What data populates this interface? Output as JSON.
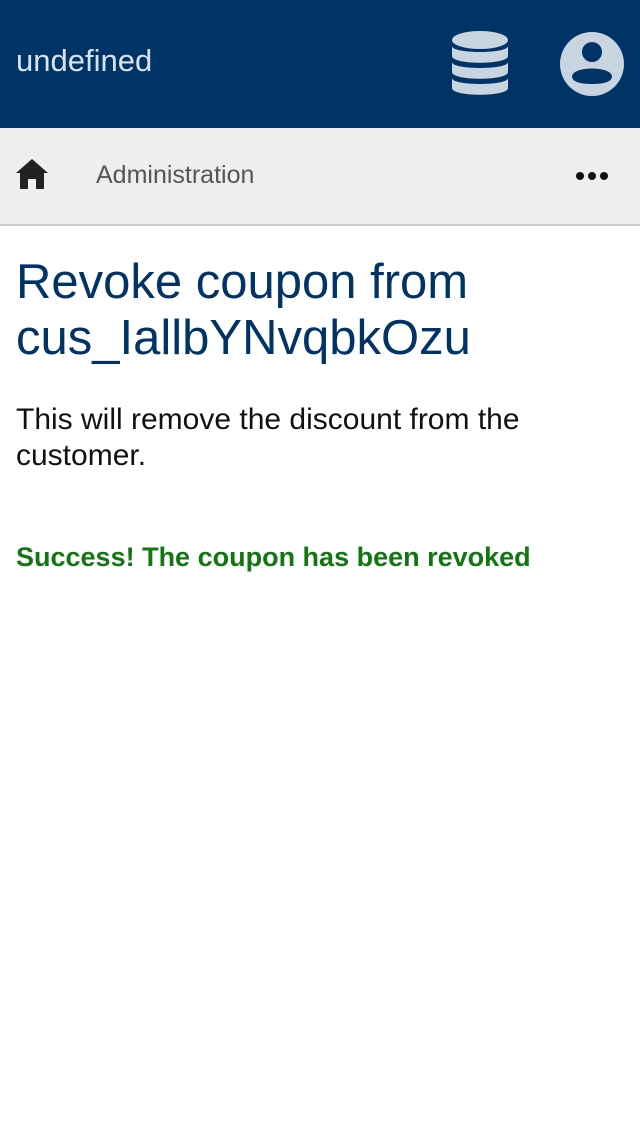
{
  "header": {
    "app_title": "undefined",
    "database_icon": "database-icon",
    "account_icon": "account-circle-icon",
    "background_color": "#003366",
    "icon_color": "#c8d4e0"
  },
  "breadcrumb": {
    "home_icon": "home-icon",
    "current": "Administration",
    "more_icon": "more-horizontal-icon"
  },
  "main": {
    "title": "Revoke coupon from cus_IallbYNvqbkOzu",
    "description": "This will remove the discount from the customer.",
    "success_message": "Success! The coupon has been revoked",
    "success_color": "#117711"
  }
}
